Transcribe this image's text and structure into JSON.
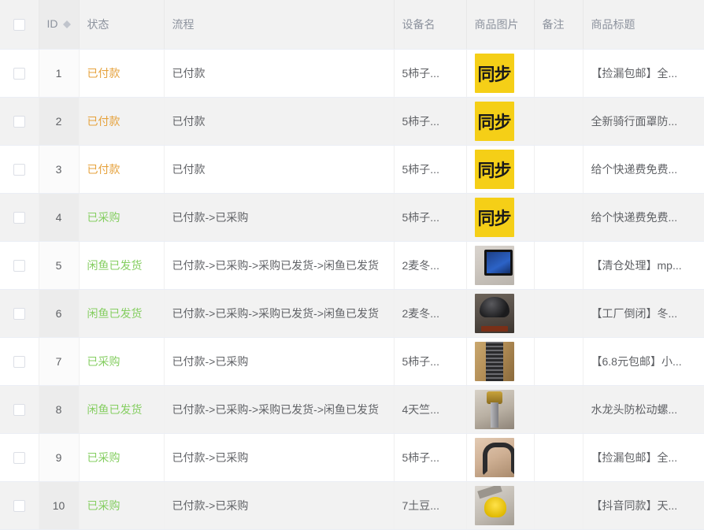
{
  "table": {
    "columns": [
      {
        "key": "check",
        "label": "",
        "icon": "checkbox"
      },
      {
        "key": "id",
        "label": "ID",
        "sortable": true,
        "sort_icon": "sort-caret-icon"
      },
      {
        "key": "status",
        "label": "状态"
      },
      {
        "key": "flow",
        "label": "流程"
      },
      {
        "key": "device",
        "label": "设备名"
      },
      {
        "key": "image",
        "label": "商品图片"
      },
      {
        "key": "note",
        "label": "备注"
      },
      {
        "key": "title",
        "label": "商品标题"
      }
    ],
    "rows": [
      {
        "id": "1",
        "status": "已付款",
        "status_type": "paid",
        "flow": "已付款",
        "device": "5柿子...",
        "image_kind": "sync",
        "image_text": "同步",
        "note": "",
        "title": "【捡漏包邮】全..."
      },
      {
        "id": "2",
        "status": "已付款",
        "status_type": "paid",
        "flow": "已付款",
        "device": "5柿子...",
        "image_kind": "sync",
        "image_text": "同步",
        "note": "",
        "title": "全新骑行面罩防..."
      },
      {
        "id": "3",
        "status": "已付款",
        "status_type": "paid",
        "flow": "已付款",
        "device": "5柿子...",
        "image_kind": "sync",
        "image_text": "同步",
        "note": "",
        "title": "给个快递费免费..."
      },
      {
        "id": "4",
        "status": "已采购",
        "status_type": "purchased",
        "flow": "已付款->已采购",
        "device": "5柿子...",
        "image_kind": "sync",
        "image_text": "同步",
        "note": "",
        "title": "给个快递费免费..."
      },
      {
        "id": "5",
        "status": "闲鱼已发货",
        "status_type": "shipped",
        "flow": "已付款->已采购->采购已发货->闲鱼已发货",
        "device": "2麦冬...",
        "image_kind": "photo-a",
        "image_text": "",
        "note": "",
        "title": "【清仓处理】mp..."
      },
      {
        "id": "6",
        "status": "闲鱼已发货",
        "status_type": "shipped",
        "flow": "已付款->已采购->采购已发货->闲鱼已发货",
        "device": "2麦冬...",
        "image_kind": "photo-b",
        "image_text": "",
        "note": "",
        "title": "【工厂倒闭】冬..."
      },
      {
        "id": "7",
        "status": "已采购",
        "status_type": "purchased",
        "flow": "已付款->已采购",
        "device": "5柿子...",
        "image_kind": "photo-c",
        "image_text": "",
        "note": "",
        "title": "【6.8元包邮】小..."
      },
      {
        "id": "8",
        "status": "闲鱼已发货",
        "status_type": "shipped",
        "flow": "已付款->已采购->采购已发货->闲鱼已发货",
        "device": "4天竺...",
        "image_kind": "photo-d",
        "image_text": "",
        "note": "",
        "title": "水龙头防松动螺..."
      },
      {
        "id": "9",
        "status": "已采购",
        "status_type": "purchased",
        "flow": "已付款->已采购",
        "device": "5柿子...",
        "image_kind": "photo-e",
        "image_text": "",
        "note": "",
        "title": "【捡漏包邮】全..."
      },
      {
        "id": "10",
        "status": "已采购",
        "status_type": "purchased",
        "flow": "已付款->已采购",
        "device": "7土豆...",
        "image_kind": "photo-f",
        "image_text": "",
        "note": "",
        "title": "【抖音同款】天..."
      }
    ]
  },
  "colors": {
    "status_paid": "#e6a23c",
    "status_purchased": "#85ce61",
    "status_shipped": "#85ce61",
    "header_bg": "#f2f2f2",
    "stripe_bg": "#f2f2f2",
    "thumb_sync_bg": "#f5cf17",
    "text": "#606266"
  }
}
